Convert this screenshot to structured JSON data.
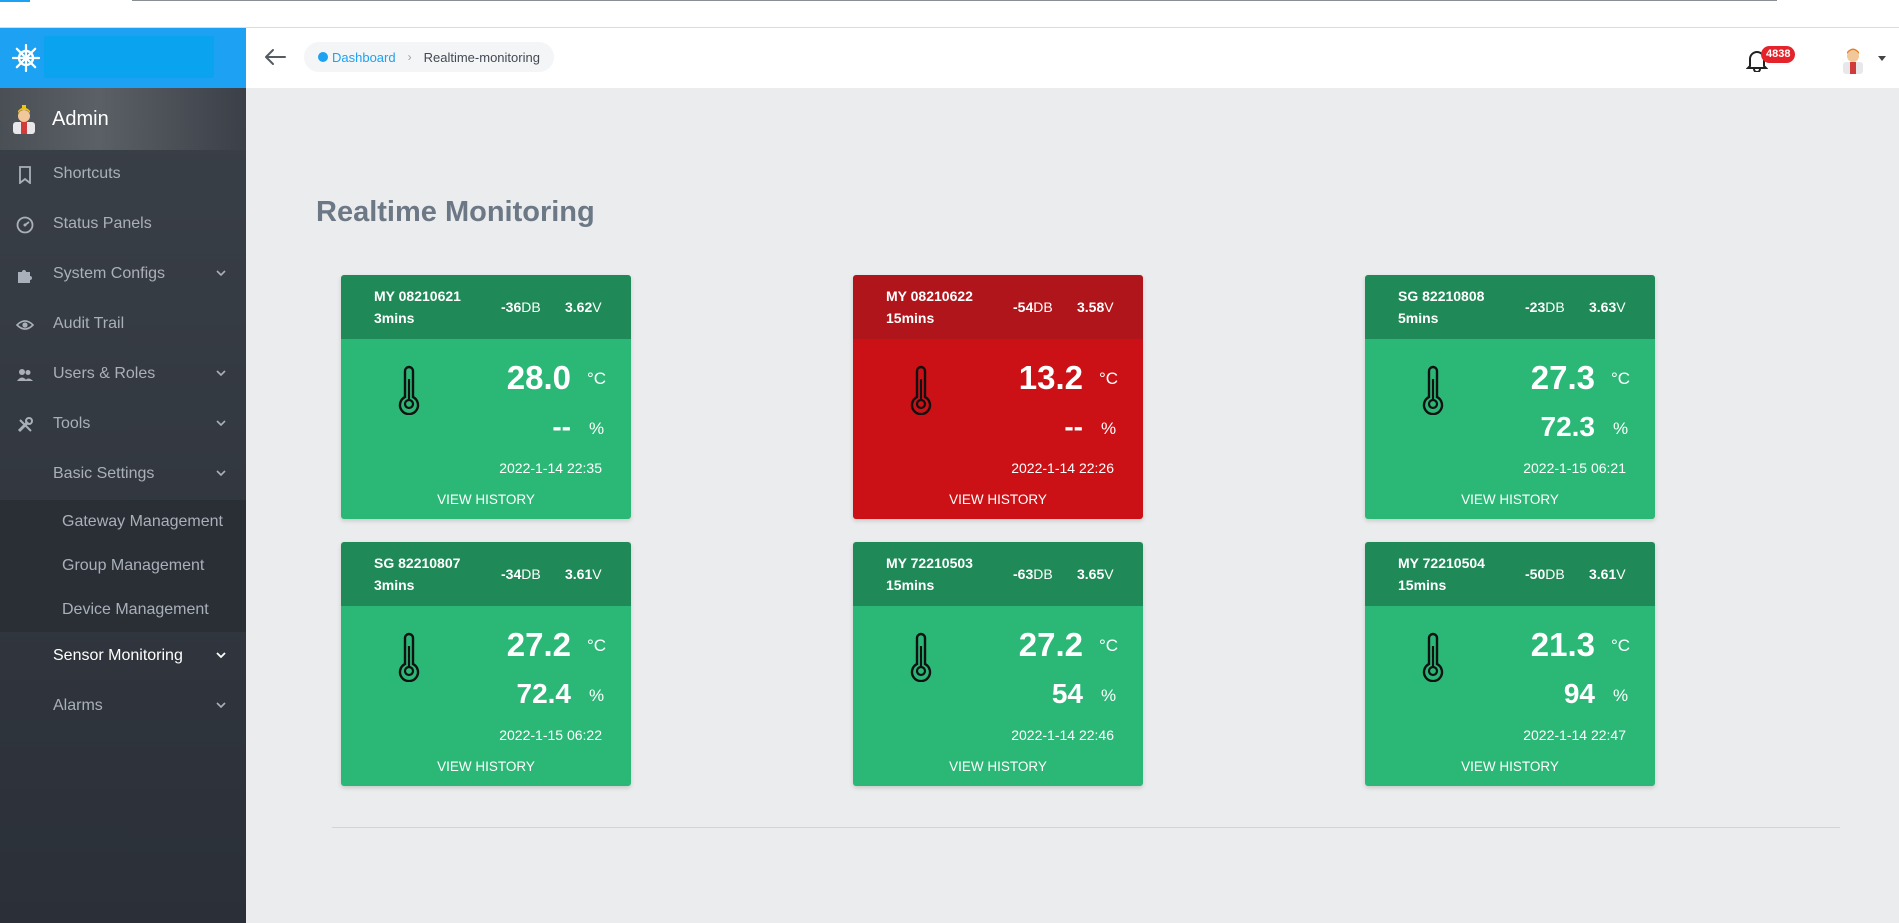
{
  "sidebar": {
    "user": "Admin",
    "items": [
      {
        "label": "Shortcuts",
        "icon": "bookmark-icon"
      },
      {
        "label": "Status Panels",
        "icon": "gauge-icon"
      },
      {
        "label": "System Configs",
        "icon": "puzzle-icon"
      },
      {
        "label": "Audit Trail",
        "icon": "eye-icon"
      },
      {
        "label": "Users & Roles",
        "icon": "users-icon"
      },
      {
        "label": "Tools",
        "icon": "tools-icon"
      }
    ],
    "basic_settings": "Basic Settings",
    "basic_children": [
      "Gateway Management",
      "Group Management",
      "Device Management"
    ],
    "sensor_monitoring": "Sensor Monitoring",
    "alarms": "Alarms"
  },
  "header": {
    "breadcrumb_home": "Dashboard",
    "breadcrumb_current": "Realtime-monitoring",
    "notification_count": "4838"
  },
  "page": {
    "title": "Realtime Monitoring"
  },
  "cards": [
    {
      "device": "MY 08210621",
      "age": "3mins",
      "signal": "-36",
      "signal_unit": "DB",
      "voltage": "3.62",
      "voltage_unit": "V",
      "temperature": "28.0",
      "temp_unit": "°C",
      "humidity": "--",
      "hum_unit": "%",
      "timestamp": "2022-1-14 22:35",
      "action": "VIEW HISTORY",
      "status": "ok"
    },
    {
      "device": "MY 08210622",
      "age": "15mins",
      "signal": "-54",
      "signal_unit": "DB",
      "voltage": "3.58",
      "voltage_unit": "V",
      "temperature": "13.2",
      "temp_unit": "°C",
      "humidity": "--",
      "hum_unit": "%",
      "timestamp": "2022-1-14 22:26",
      "action": "VIEW HISTORY",
      "status": "alarm"
    },
    {
      "device": "SG 82210808",
      "age": "5mins",
      "signal": "-23",
      "signal_unit": "DB",
      "voltage": "3.63",
      "voltage_unit": "V",
      "temperature": "27.3",
      "temp_unit": "°C",
      "humidity": "72.3",
      "hum_unit": "%",
      "timestamp": "2022-1-15 06:21",
      "action": "VIEW HISTORY",
      "status": "ok"
    },
    {
      "device": "SG 82210807",
      "age": "3mins",
      "signal": "-34",
      "signal_unit": "DB",
      "voltage": "3.61",
      "voltage_unit": "V",
      "temperature": "27.2",
      "temp_unit": "°C",
      "humidity": "72.4",
      "hum_unit": "%",
      "timestamp": "2022-1-15 06:22",
      "action": "VIEW HISTORY",
      "status": "ok"
    },
    {
      "device": "MY 72210503",
      "age": "15mins",
      "signal": "-63",
      "signal_unit": "DB",
      "voltage": "3.65",
      "voltage_unit": "V",
      "temperature": "27.2",
      "temp_unit": "°C",
      "humidity": "54",
      "hum_unit": "%",
      "timestamp": "2022-1-14 22:46",
      "action": "VIEW HISTORY",
      "status": "ok"
    },
    {
      "device": "MY 72210504",
      "age": "15mins",
      "signal": "-50",
      "signal_unit": "DB",
      "voltage": "3.61",
      "voltage_unit": "V",
      "temperature": "21.3",
      "temp_unit": "°C",
      "humidity": "94",
      "hum_unit": "%",
      "timestamp": "2022-1-14 22:47",
      "action": "VIEW HISTORY",
      "status": "ok"
    }
  ],
  "colors": {
    "brand": "#1da1f2",
    "ok_header": "#1f8a57",
    "ok_body": "#2bb877",
    "alarm_header": "#b0151b",
    "alarm_body": "#cb1116",
    "badge": "#e5232b"
  }
}
